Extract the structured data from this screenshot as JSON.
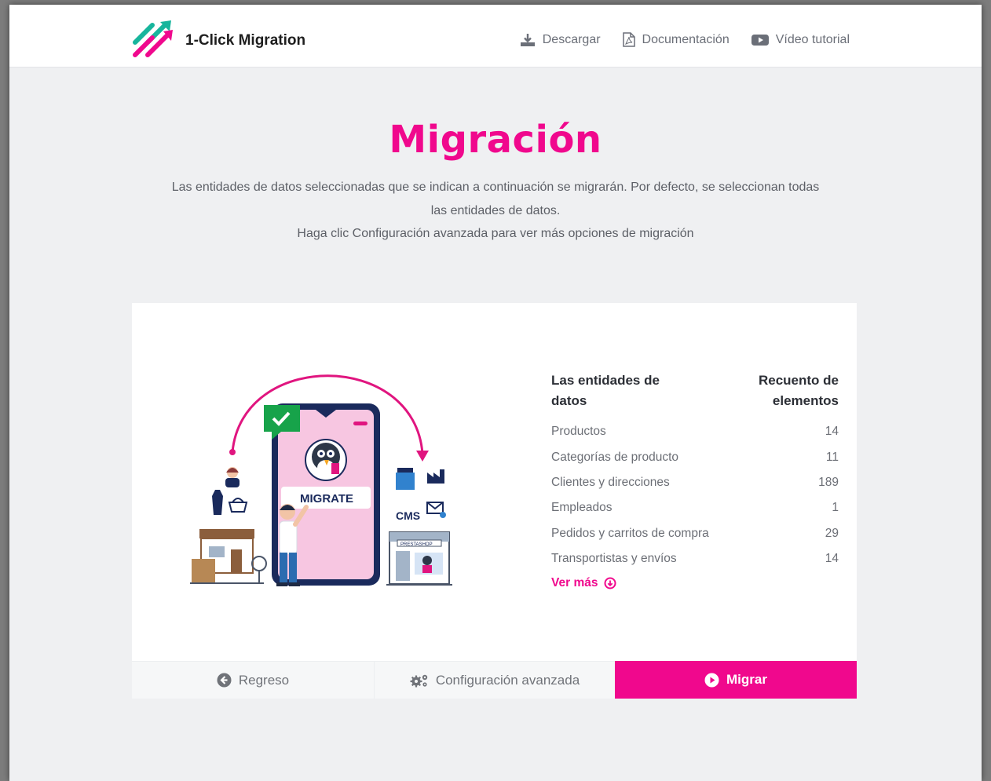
{
  "app": {
    "name": "1-Click Migration"
  },
  "nav": {
    "download": "Descargar",
    "docs": "Documentación",
    "video": "Vídeo tutorial"
  },
  "hero": {
    "title": "Migración",
    "line1": "Las entidades de datos seleccionadas que se indican a continuación se migrarán. Por defecto, se seleccionan todas las entidades de datos.",
    "line2": "Haga clic Configuración avanzada para ver más opciones de migración"
  },
  "illustration": {
    "migrate_label": "MIGRATE",
    "cms_label": "CMS",
    "shop_label": "PRESTASHOP"
  },
  "table": {
    "col_entities": "Las entidades de datos",
    "col_count": "Recuento de elementos",
    "rows": [
      {
        "name": "Productos",
        "count": "14"
      },
      {
        "name": "Categorías de producto",
        "count": "11"
      },
      {
        "name": "Clientes y direcciones",
        "count": "189"
      },
      {
        "name": "Empleados",
        "count": "1"
      },
      {
        "name": "Pedidos y carritos de compra",
        "count": "29"
      },
      {
        "name": "Transportistas y envíos",
        "count": "14"
      }
    ],
    "see_more": "Ver más"
  },
  "actions": {
    "back": "Regreso",
    "advanced": "Configuración avanzada",
    "migrate": "Migrar"
  },
  "colors": {
    "accent": "#f0088d",
    "teal": "#17b59c",
    "background": "#eff0f2"
  }
}
